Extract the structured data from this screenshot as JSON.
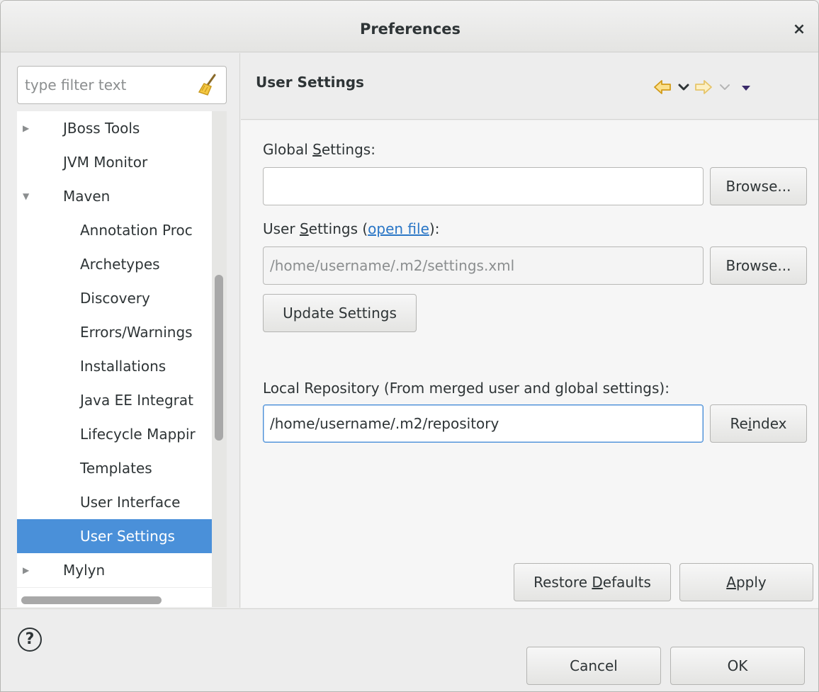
{
  "window": {
    "title": "Preferences",
    "close_glyph": "×"
  },
  "filter": {
    "placeholder": "type filter text",
    "icon": "broom-icon"
  },
  "tree": {
    "items": [
      {
        "label": "JBoss Tools",
        "expander": "collapsed",
        "level": 0
      },
      {
        "label": "JVM Monitor",
        "expander": "none",
        "level": 0
      },
      {
        "label": "Maven",
        "expander": "expanded",
        "level": 0
      },
      {
        "label": "Annotation Proc",
        "expander": "none",
        "level": 1
      },
      {
        "label": "Archetypes",
        "expander": "none",
        "level": 1
      },
      {
        "label": "Discovery",
        "expander": "none",
        "level": 1
      },
      {
        "label": "Errors/Warnings",
        "expander": "none",
        "level": 1
      },
      {
        "label": "Installations",
        "expander": "none",
        "level": 1
      },
      {
        "label": "Java EE Integrat",
        "expander": "none",
        "level": 1
      },
      {
        "label": "Lifecycle Mappir",
        "expander": "none",
        "level": 1
      },
      {
        "label": "Templates",
        "expander": "none",
        "level": 1
      },
      {
        "label": "User Interface",
        "expander": "none",
        "level": 1
      },
      {
        "label": "User Settings",
        "expander": "none",
        "level": 1,
        "selected": true
      },
      {
        "label": "Mylyn",
        "expander": "collapsed",
        "level": 0
      }
    ]
  },
  "page": {
    "title": "User Settings",
    "nav": [
      "back-arrow-icon",
      "back-menu-icon",
      "forward-arrow-icon",
      "forward-menu-icon",
      "view-menu-icon"
    ]
  },
  "global_settings": {
    "label_before": "Global ",
    "label_mnemonic": "S",
    "label_after": "ettings:",
    "value": "",
    "browse": "Browse..."
  },
  "user_settings": {
    "label_before": "User ",
    "label_mnemonic": "S",
    "label_mid": "ettings (",
    "link": "open file",
    "label_after": "):",
    "value": "/home/username/.m2/settings.xml",
    "browse": "Browse...",
    "update": "Update Settings"
  },
  "local_repository": {
    "label": "Local Repository (From merged user and global settings):",
    "value": "/home/username/.m2/repository",
    "reindex_before": "Re",
    "reindex_mnemonic": "i",
    "reindex_after": "ndex"
  },
  "actions": {
    "restore_before": "Restore ",
    "restore_mnemonic": "D",
    "restore_after": "efaults",
    "apply_mnemonic": "A",
    "apply_after": "pply"
  },
  "footer": {
    "help": "?",
    "cancel": "Cancel",
    "ok": "OK"
  },
  "colors": {
    "selection": "#4a90d9",
    "link": "#2a76c6",
    "nav_arrow": "#f2b632"
  }
}
